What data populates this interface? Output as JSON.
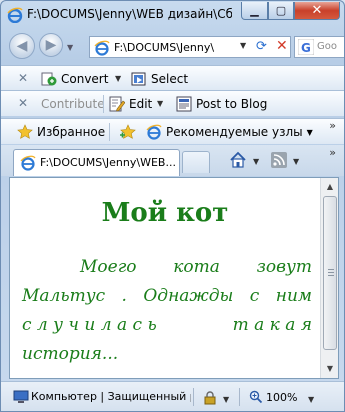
{
  "window": {
    "title": "F:\\DOCUMS\\Jenny\\WEB дизайн\\Сбо...",
    "minimize_icon": "minimize-icon",
    "maximize_icon": "maximize-icon",
    "close_icon": "close-icon"
  },
  "address_bar": {
    "url": "F:\\DOCUMS\\Jenny\\",
    "search_placeholder": "Goo"
  },
  "toolbar1": {
    "convert_label": "Convert",
    "select_label": "Select"
  },
  "toolbar2": {
    "contribute_label": "Contribute",
    "edit_label": "Edit",
    "post_label": "Post to Blog"
  },
  "favorites_bar": {
    "favorites_label": "Избранное",
    "suggested_label": "Рекомендуемые узлы",
    "more": "»"
  },
  "tabs": [
    {
      "label": "F:\\DOCUMS\\Jenny\\WEB..."
    }
  ],
  "page": {
    "heading": "Мой кот",
    "paragraph_lines": [
      [
        "Моего",
        "кота",
        "зовут"
      ],
      [
        "Мальтус",
        ".",
        "Однажды",
        "с",
        "ним"
      ],
      [
        "с л у ч и л а с ь",
        "т а к а я"
      ],
      [
        "история..."
      ]
    ]
  },
  "status_bar": {
    "zone_text": "Компьютер | Защищенный р",
    "zoom": "100%"
  },
  "colors": {
    "page_text": "#1a7d1a",
    "close_button": "#c9402a"
  }
}
